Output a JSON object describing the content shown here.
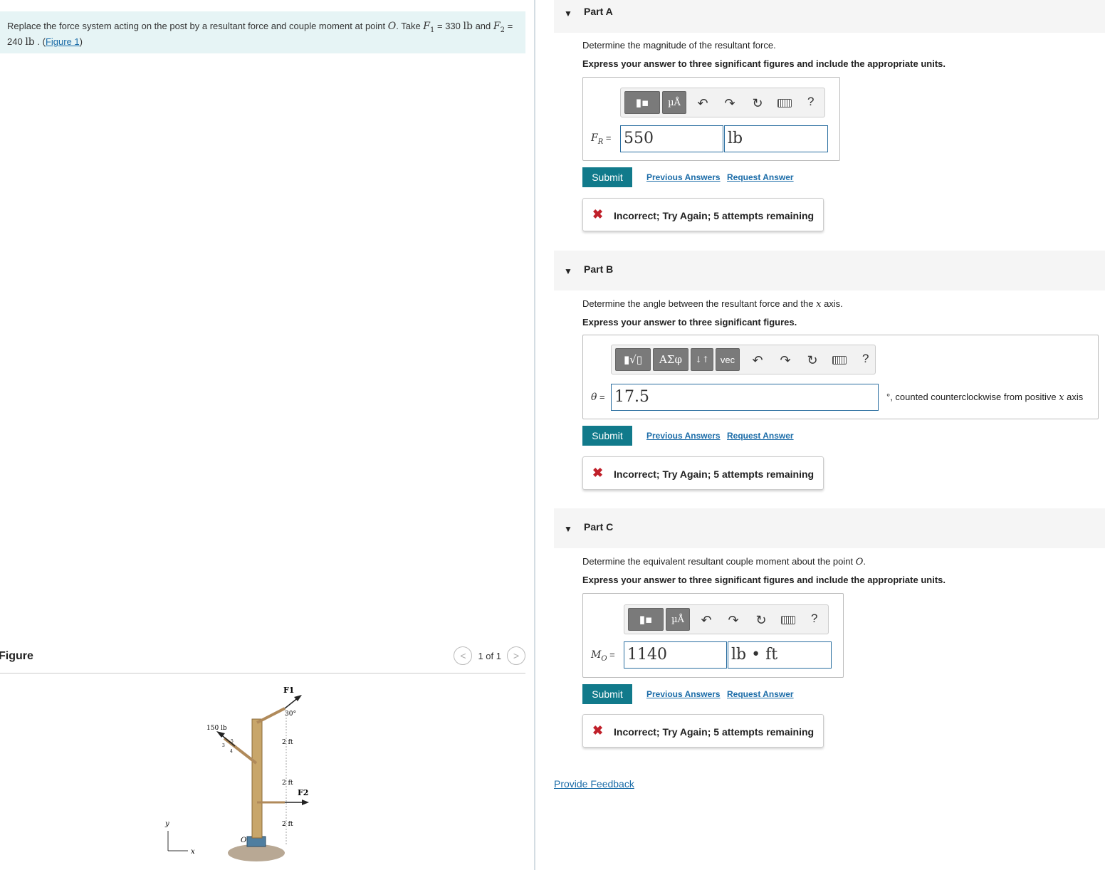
{
  "problem": {
    "text_before": "Replace the force system acting on the post by a resultant force and couple moment at point ",
    "point": "O",
    "text_take": ". Take ",
    "f1_sym": "F",
    "f1_sub": "1",
    "f1_val": " = 330 ",
    "lb": "lb",
    "and": " and ",
    "f2_sym": "F",
    "f2_sub": "2",
    "f2_eq": " =",
    "f2_val": "240 ",
    "lb2": "lb",
    "after": " . (",
    "figure_link": "Figure 1",
    "close": ")"
  },
  "figure": {
    "title": "Figure",
    "page": "1 of 1",
    "prev_glyph": "<",
    "next_glyph": ">",
    "labels": {
      "f1": "F1",
      "f2": "F2",
      "angle": "30°",
      "force150": "150 lb",
      "d1": "2 ft",
      "d2": "2 ft",
      "d3": "2 ft",
      "o": "O",
      "y": "y",
      "x": "x",
      "tri5": "5",
      "tri3": "3",
      "tri4": "4"
    }
  },
  "parts": [
    {
      "label": "Part A",
      "question": "Determine the magnitude of the resultant force.",
      "instruction": "Express your answer to three significant figures and include the appropriate units.",
      "var_name": "F",
      "var_sub": "R",
      "eq": " =",
      "value": "550",
      "units": "lb",
      "toolbar": [
        "templates",
        "µÅ",
        "undo",
        "redo",
        "reset",
        "keyboard",
        "?"
      ],
      "submit": "Submit",
      "previous_answers": "Previous Answers",
      "request_answer": "Request Answer",
      "feedback": "Incorrect; Try Again; 5 attempts remaining"
    },
    {
      "label": "Part B",
      "question_before": "Determine the angle between the resultant force and the ",
      "question_var": "x",
      "question_after": " axis.",
      "instruction": "Express your answer to three significant figures.",
      "var_name": "θ",
      "eq": " =",
      "value": "17.5",
      "units_note_before": "°, counted counterclockwise from positive ",
      "units_note_var": "x",
      "units_note_after": " axis",
      "toolbar": [
        "templates",
        "ΑΣφ",
        "↓↑",
        "vec",
        "undo",
        "redo",
        "reset",
        "keyboard",
        "?"
      ],
      "submit": "Submit",
      "previous_answers": "Previous Answers",
      "request_answer": "Request Answer",
      "feedback": "Incorrect; Try Again; 5 attempts remaining"
    },
    {
      "label": "Part C",
      "question_before": "Determine the equivalent resultant couple moment about the point ",
      "question_var": "O",
      "question_after": ".",
      "instruction": "Express your answer to three significant figures and include the appropriate units.",
      "var_name": "M",
      "var_sub": "O",
      "eq": " =",
      "value": "1140",
      "units": "lb • ft",
      "toolbar": [
        "templates",
        "µÅ",
        "undo",
        "redo",
        "reset",
        "keyboard",
        "?"
      ],
      "submit": "Submit",
      "previous_answers": "Previous Answers",
      "request_answer": "Request Answer",
      "feedback": "Incorrect; Try Again; 5 attempts remaining"
    }
  ],
  "footer": {
    "provide_feedback": "Provide Feedback"
  },
  "colors": {
    "accent": "#117a8b",
    "link": "#1b6ca8",
    "error": "#c0202a",
    "problem_bg": "#e6f4f5"
  }
}
